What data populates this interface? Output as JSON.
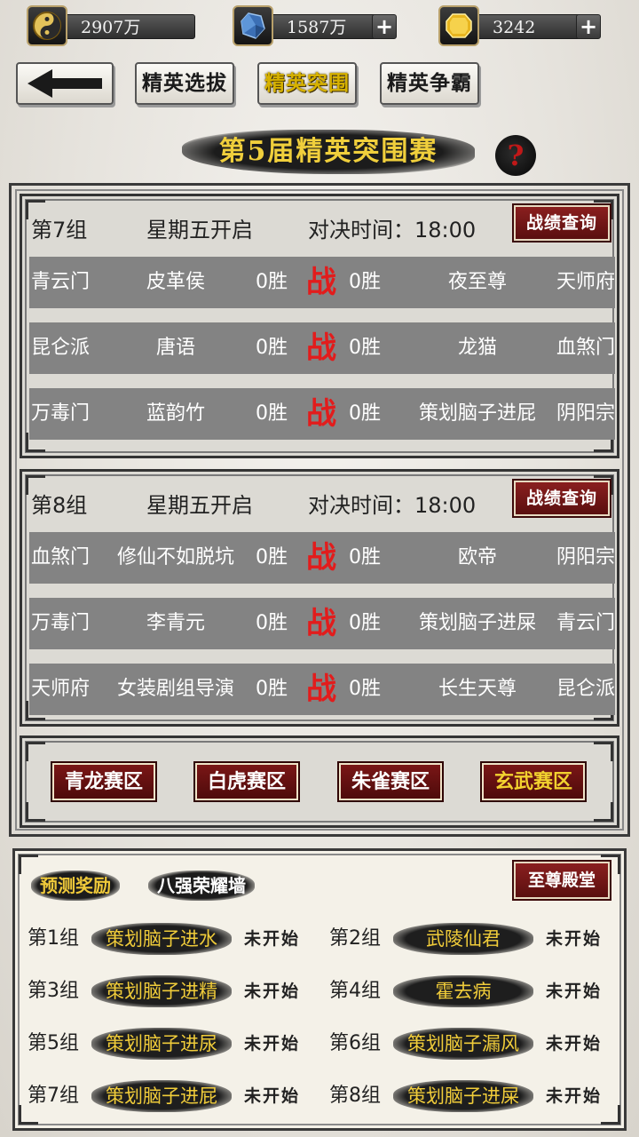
{
  "resources": {
    "coins": {
      "value": "2907万",
      "icon": "yin-yang-coin-icon"
    },
    "crystal": {
      "value": "1587万",
      "icon": "blue-crystal-icon",
      "plus": "+"
    },
    "gold": {
      "value": "3242",
      "icon": "gold-ingot-icon",
      "plus": "+"
    }
  },
  "nav": {
    "back_icon": "back-arrow-icon",
    "tabs": [
      "精英选拔",
      "精英突围",
      "精英争霸"
    ],
    "active_tab": 1
  },
  "title": "第5届精英突围赛",
  "help": "?",
  "groups": [
    {
      "name": "第7组",
      "day": "星期五开启",
      "time": "对决时间：18:00",
      "record_btn": "战绩查询",
      "matches": [
        {
          "sect_a": "青云门",
          "player_a": "皮革侯",
          "wins_a": "0胜",
          "vs": "战",
          "wins_b": "0胜",
          "player_b": "夜至尊",
          "sect_b": "天师府"
        },
        {
          "sect_a": "昆仑派",
          "player_a": "唐语",
          "wins_a": "0胜",
          "vs": "战",
          "wins_b": "0胜",
          "player_b": "龙猫",
          "sect_b": "血煞门"
        },
        {
          "sect_a": "万毒门",
          "player_a": "蓝韵竹",
          "wins_a": "0胜",
          "vs": "战",
          "wins_b": "0胜",
          "player_b": "策划脑子进屁",
          "sect_b": "阴阳宗"
        }
      ]
    },
    {
      "name": "第8组",
      "day": "星期五开启",
      "time": "对决时间：18:00",
      "record_btn": "战绩查询",
      "matches": [
        {
          "sect_a": "血煞门",
          "player_a": "修仙不如脱坑",
          "wins_a": "0胜",
          "vs": "战",
          "wins_b": "0胜",
          "player_b": "欧帝",
          "sect_b": "阴阳宗"
        },
        {
          "sect_a": "万毒门",
          "player_a": "李青元",
          "wins_a": "0胜",
          "vs": "战",
          "wins_b": "0胜",
          "player_b": "策划脑子进屎",
          "sect_b": "青云门"
        },
        {
          "sect_a": "天师府",
          "player_a": "女装剧组导演",
          "wins_a": "0胜",
          "vs": "战",
          "wins_b": "0胜",
          "player_b": "长生天尊",
          "sect_b": "昆仑派"
        }
      ]
    }
  ],
  "zones": [
    "青龙赛区",
    "白虎赛区",
    "朱雀赛区",
    "玄武赛区"
  ],
  "active_zone": 3,
  "predictions": {
    "tabs": [
      "预测奖励",
      "八强荣耀墙"
    ],
    "active_tab": 0,
    "hall_btn": "至尊殿堂",
    "rows": [
      {
        "group": "第1组",
        "player": "策划脑子进水",
        "status": "未开始"
      },
      {
        "group": "第2组",
        "player": "武陵仙君",
        "status": "未开始"
      },
      {
        "group": "第3组",
        "player": "策划脑子进精",
        "status": "未开始"
      },
      {
        "group": "第4组",
        "player": "霍去病",
        "status": "未开始"
      },
      {
        "group": "第5组",
        "player": "策划脑子进尿",
        "status": "未开始"
      },
      {
        "group": "第6组",
        "player": "策划脑子漏风",
        "status": "未开始"
      },
      {
        "group": "第7组",
        "player": "策划脑子进屁",
        "status": "未开始"
      },
      {
        "group": "第8组",
        "player": "策划脑子进屎",
        "status": "未开始"
      }
    ]
  }
}
